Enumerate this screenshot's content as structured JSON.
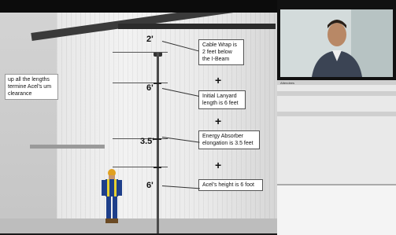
{
  "scene": {
    "note": "up all the lengths termine Acel's um clearance",
    "dims": [
      "2'",
      "6'",
      "3.5'",
      "6'"
    ],
    "callouts": [
      "Cable Wrap is 2 feet below the I-Beam",
      "Initial Lanyard length is 6 feet",
      "Energy Absorber elongation is 3.5 feet",
      "Acel's height is 6 foot"
    ],
    "plus": "+"
  },
  "video": {
    "name": ""
  },
  "sidebar": {
    "rows": [
      "Attendees",
      "",
      "",
      "",
      "",
      "",
      "",
      "",
      "",
      "",
      "",
      "",
      "",
      "",
      ""
    ]
  }
}
